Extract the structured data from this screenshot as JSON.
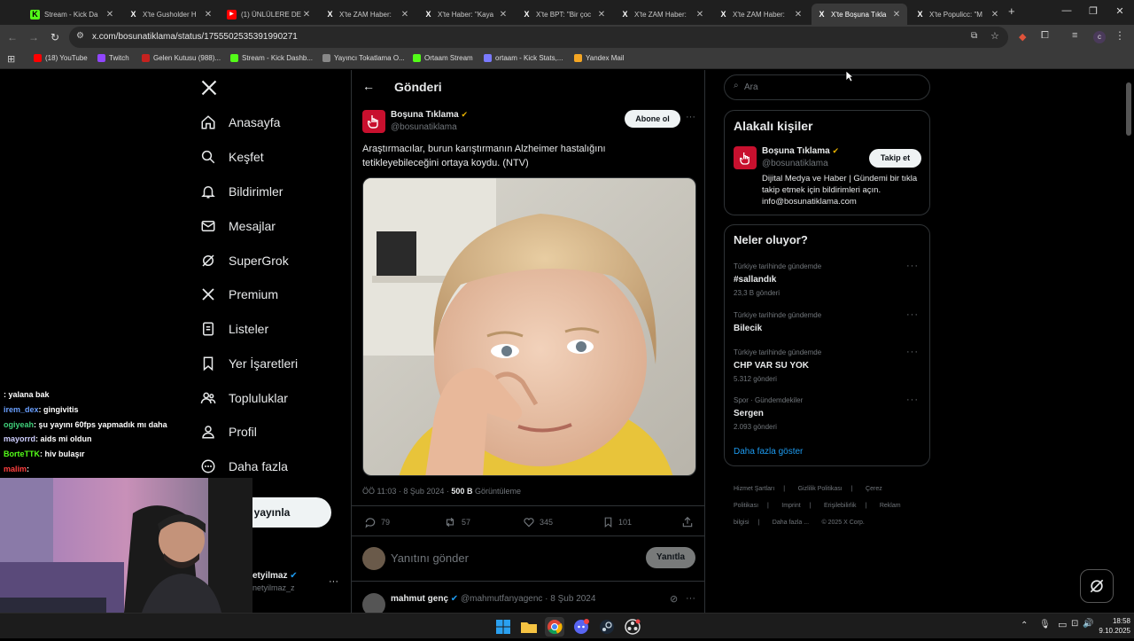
{
  "browser": {
    "tabs": [
      {
        "title": "Stream - Kick Da",
        "favicon": "kick-icon",
        "active": false
      },
      {
        "title": "X'te Gusholder H",
        "favicon": "x-icon",
        "active": false
      },
      {
        "title": "(1) ÜNLÜLERE DE",
        "favicon": "youtube-icon",
        "active": false
      },
      {
        "title": "X'te ZAM Haber:",
        "favicon": "x-icon",
        "active": false
      },
      {
        "title": "X'te Haber: \"Kaya",
        "favicon": "x-icon",
        "active": false
      },
      {
        "title": "X'te BPT: \"Bir çoc",
        "favicon": "x-icon",
        "active": false
      },
      {
        "title": "X'te ZAM Haber:",
        "favicon": "x-icon",
        "active": false
      },
      {
        "title": "X'te ZAM Haber:",
        "favicon": "x-icon",
        "active": false
      },
      {
        "title": "X'te Boşuna Tıkla",
        "favicon": "x-icon",
        "active": true
      },
      {
        "title": "X'te Populicc: \"M",
        "favicon": "x-icon",
        "active": false
      }
    ],
    "new_tab": "+",
    "url": "x.com/bosunatiklama/status/1755502535391990271",
    "bookmarks": [
      {
        "label": "(18) YouTube",
        "icon": "youtube-icon",
        "color": "#ff0000"
      },
      {
        "label": "Twitch",
        "icon": "twitch-icon",
        "color": "#9146ff"
      },
      {
        "label": "Gelen Kutusu (988)...",
        "icon": "mail-icon",
        "color": "#c5221f"
      },
      {
        "label": "Stream - Kick Dashb...",
        "icon": "kick-icon",
        "color": "#53fc18"
      },
      {
        "label": "Yayıncı Tokatlama O...",
        "icon": "globe-icon",
        "color": "#888888"
      },
      {
        "label": "Ortaam Stream",
        "icon": "kick-icon",
        "color": "#53fc18"
      },
      {
        "label": "ortaam - Kick Stats,...",
        "icon": "stats-icon",
        "color": "#7a7aff"
      },
      {
        "label": "Yandex Mail",
        "icon": "mail-icon",
        "color": "#f5a623"
      }
    ]
  },
  "nav": {
    "items": [
      "Anasayfa",
      "Keşfet",
      "Bildirimler",
      "Mesajlar",
      "SuperGrok",
      "Premium",
      "Listeler",
      "Yer İşaretleri",
      "Topluluklar",
      "Profil",
      "Daha fazla"
    ],
    "post_button": "eri yayınla",
    "account": {
      "name": "etyilmaz",
      "handle": "netyilmaz_z"
    }
  },
  "post": {
    "header": "Gönderi",
    "author_name": "Boşuna Tıklama",
    "author_handle": "@bosunatiklama",
    "subscribe": "Abone ol",
    "text": "Araştırmacılar, burun karıştırmanın Alzheimer hastalığını tetikleyebileceğini ortaya koydu. (NTV)",
    "time": "ÖÖ 11:03 · 8 Şub 2024 ·",
    "views": "500 B",
    "views_label": "Görüntüleme",
    "replies": "79",
    "reposts": "57",
    "likes": "345",
    "bookmarks": "101",
    "reply_placeholder": "Yanıtını gönder",
    "reply_button": "Yanıtla"
  },
  "reply": {
    "name": "mahmut genç",
    "handle": "@mahmutfanyagenc · 8 Şub 2024"
  },
  "search": {
    "placeholder": "Ara"
  },
  "relevant": {
    "title": "Alakalı kişiler",
    "name": "Boşuna Tıklama",
    "handle": "@bosunatiklama",
    "follow": "Takip et",
    "bio": "Dijital Medya ve Haber | Gündemi bir tıkla takip etmek için bildirimleri açın. info@bosunatiklama.com"
  },
  "trends": {
    "title": "Neler oluyor?",
    "items": [
      {
        "context": "Türkiye tarihinde gündemde",
        "name": "#sallandık",
        "posts": "23,3 B gönderi"
      },
      {
        "context": "Türkiye tarihinde gündemde",
        "name": "Bilecik",
        "posts": ""
      },
      {
        "context": "Türkiye tarihinde gündemde",
        "name": "CHP VAR SU YOK",
        "posts": "5.312 gönderi"
      },
      {
        "context": "Spor · Gündemdekiler",
        "name": "Sergen",
        "posts": "2.093 gönderi"
      }
    ],
    "show_more": "Daha fazla göster"
  },
  "footer": {
    "links": [
      "Hizmet Şartları",
      "Gizlilik Politikası",
      "Çerez Politikası",
      "Imprint",
      "Erişilebilirlik",
      "Reklam bilgisi",
      "Daha fazla ..."
    ],
    "copyright": "© 2025 X Corp."
  },
  "chat": [
    {
      "user": "",
      "msg": ": yalana bak",
      "color": "#b04040"
    },
    {
      "user": "irem_dex",
      "msg": ": gingivitis",
      "color": "#6aa0ff"
    },
    {
      "user": "ogiyeah",
      "msg": ": şu yayını 60fps yapmadık mı daha",
      "color": "#3fd07a"
    },
    {
      "user": "mayorrd",
      "msg": ": aids mi oldun",
      "color": "#cfcfff"
    },
    {
      "user": "BorteTTK",
      "msg": ": hiv bulaşır",
      "color": "#53fc18"
    },
    {
      "user": "malim",
      "msg": ":",
      "color": "#ff4040"
    }
  ],
  "taskbar": {
    "time": "18:58",
    "date": "9.10.2025"
  },
  "colors": {
    "accent": "#1d9bf0",
    "brand_red": "#c8102e",
    "kick_green": "#53fc18"
  }
}
